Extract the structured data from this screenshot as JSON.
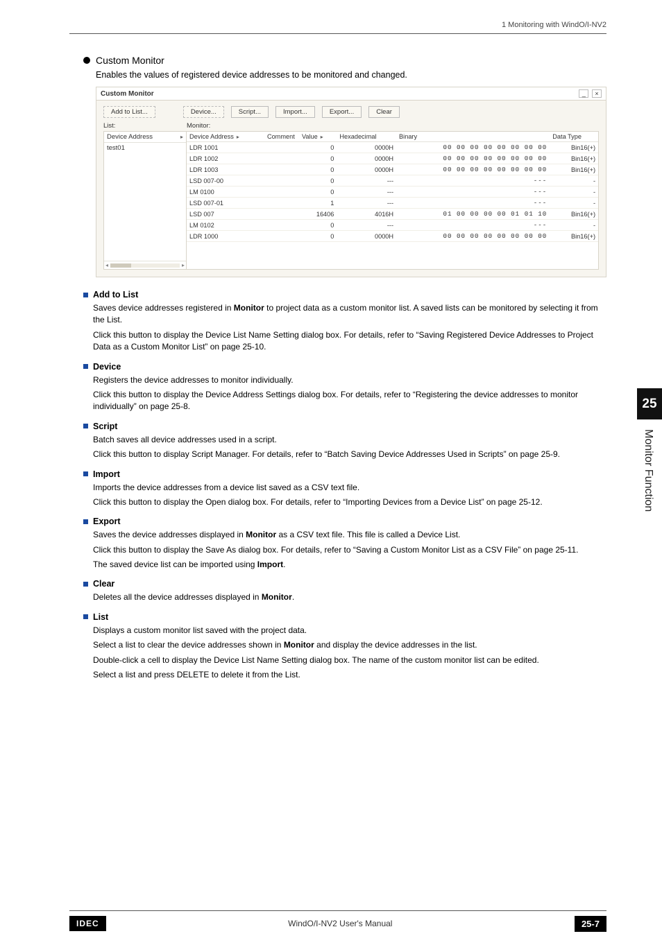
{
  "header": {
    "breadcrumb": "1 Monitoring with WindO/I-NV2"
  },
  "heading": {
    "title": "Custom Monitor",
    "intro": "Enables the values of registered device addresses to be monitored and changed."
  },
  "dialog": {
    "title": "Custom Monitor",
    "buttons": {
      "add": "Add to List...",
      "device": "Device...",
      "script": "Script...",
      "import": "Import...",
      "export": "Export...",
      "clear": "Clear"
    },
    "labels": {
      "list": "List:",
      "monitor": "Monitor:"
    },
    "list_header": "Device Address",
    "list_rows": [
      "test01"
    ],
    "monitor_headers": {
      "dev": "Device Address",
      "comment": "Comment",
      "value": "Value",
      "hex": "Hexadecimal",
      "bin": "Binary",
      "dtype": "Data Type"
    },
    "monitor_rows": [
      {
        "dev": "LDR 1001",
        "comment": "",
        "value": "0",
        "hex": "0000H",
        "bin": "00 00 00 00 00 00 00 00",
        "dtype": "Bin16(+)"
      },
      {
        "dev": "LDR 1002",
        "comment": "",
        "value": "0",
        "hex": "0000H",
        "bin": "00 00 00 00 00 00 00 00",
        "dtype": "Bin16(+)"
      },
      {
        "dev": "LDR 1003",
        "comment": "",
        "value": "0",
        "hex": "0000H",
        "bin": "00 00 00 00 00 00 00 00",
        "dtype": "Bin16(+)"
      },
      {
        "dev": "LSD 007-00",
        "comment": "",
        "value": "0",
        "hex": "---",
        "bin": "---",
        "dtype": "-"
      },
      {
        "dev": "LM 0100",
        "comment": "",
        "value": "0",
        "hex": "---",
        "bin": "---",
        "dtype": "-"
      },
      {
        "dev": "LSD 007-01",
        "comment": "",
        "value": "1",
        "hex": "---",
        "bin": "---",
        "dtype": "-"
      },
      {
        "dev": "LSD 007",
        "comment": "",
        "value": "16406",
        "hex": "4016H",
        "bin": "01 00 00 00 00 01 01 10",
        "dtype": "Bin16(+)"
      },
      {
        "dev": "LM 0102",
        "comment": "",
        "value": "0",
        "hex": "---",
        "bin": "---",
        "dtype": "-"
      },
      {
        "dev": "LDR 1000",
        "comment": "",
        "value": "0",
        "hex": "0000H",
        "bin": "00 00 00 00 00 00 00 00",
        "dtype": "Bin16(+)"
      }
    ]
  },
  "sections": {
    "add": {
      "title": "Add to List",
      "p1a": "Saves device addresses registered in ",
      "p1b": "Monitor",
      "p1c": " to project data as a custom monitor list. A saved lists can be monitored by selecting it from the List.",
      "p2": "Click this button to display the Device List Name Setting dialog box. For details, refer to “Saving Registered Device Addresses to Project Data as a Custom Monitor List” on page 25-10."
    },
    "device": {
      "title": "Device",
      "p1": "Registers the device addresses to monitor individually.",
      "p2": "Click this button to display the Device Address Settings dialog box. For details, refer to “Registering the device addresses to monitor individually” on page 25-8."
    },
    "script": {
      "title": "Script",
      "p1": "Batch saves all device addresses used in a script.",
      "p2": "Click this button to display Script Manager. For details, refer to “Batch Saving Device Addresses Used in Scripts” on page 25-9."
    },
    "import": {
      "title": "Import",
      "p1": "Imports the device addresses from a device list saved as a CSV text file.",
      "p2": "Click this button to display the Open dialog box. For details, refer to “Importing Devices from a Device List” on page 25-12."
    },
    "export": {
      "title": "Export",
      "p1a": "Saves the device addresses displayed in ",
      "p1b": "Monitor",
      "p1c": " as a CSV text file. This file is called a Device List.",
      "p2": "Click this button to display the Save As dialog box. For details, refer to “Saving a Custom Monitor List as a CSV File” on page 25-11.",
      "p3a": "The saved device list can be imported using ",
      "p3b": "Import",
      "p3c": "."
    },
    "clear": {
      "title": "Clear",
      "p1a": "Deletes all the device addresses displayed in ",
      "p1b": "Monitor",
      "p1c": "."
    },
    "list": {
      "title": "List",
      "p1": "Displays a custom monitor list saved with the project data.",
      "p2a": "Select a list to clear the device addresses shown in ",
      "p2b": "Monitor",
      "p2c": " and display the device addresses in the list.",
      "p3": "Double-click a cell to display the Device List Name Setting dialog box. The name of the custom monitor list can be edited.",
      "p4": "Select a list and press DELETE to delete it from the List."
    }
  },
  "sidebar": {
    "num": "25",
    "label": "Monitor Function"
  },
  "footer": {
    "brand": "IDEC",
    "manual": "WindO/I-NV2 User's Manual",
    "page": "25-7"
  }
}
